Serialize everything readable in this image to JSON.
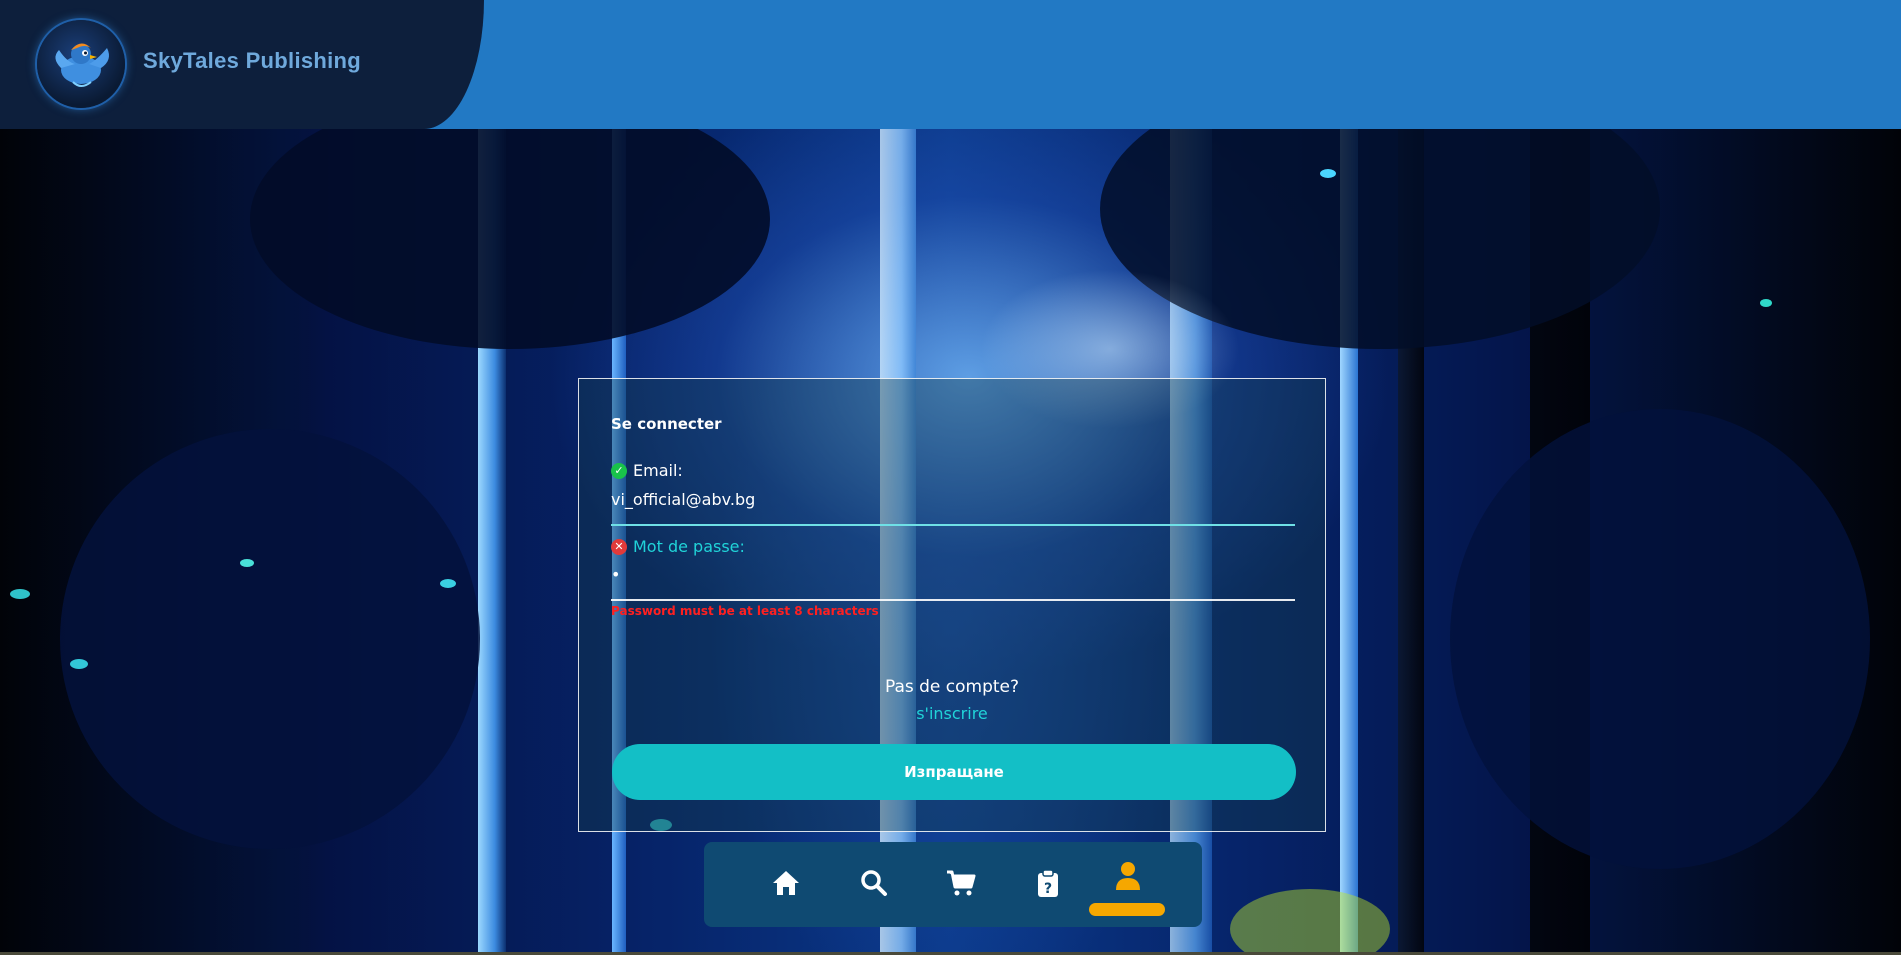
{
  "header": {
    "brand_name": "SkyTales Publishing",
    "logo_icon": "bird-logo-icon",
    "bar_color": "#2279c4",
    "panel_color": "#0d1f3c"
  },
  "login": {
    "title": "Se connecter",
    "email": {
      "label": "Email:",
      "value": "vi_official@abv.bg",
      "status": "valid",
      "status_icon": "check-circle-icon"
    },
    "password": {
      "label": "Mot de passe:",
      "value": "•",
      "status": "invalid",
      "status_icon": "x-circle-icon",
      "error": "Password must be at least 8 characters"
    },
    "no_account_text": "Pas de compte?",
    "signup_link": "s'inscrire",
    "submit_label": "Изпращане",
    "accent_color": "#13bfc6",
    "error_color": "#ff2020"
  },
  "nav": {
    "items": [
      {
        "name": "home",
        "icon": "home-icon"
      },
      {
        "name": "search",
        "icon": "search-icon"
      },
      {
        "name": "cart",
        "icon": "cart-icon"
      },
      {
        "name": "orders",
        "icon": "clipboard-question-icon"
      },
      {
        "name": "profile",
        "icon": "user-icon",
        "active": true
      }
    ],
    "active_color": "#f6a700"
  }
}
